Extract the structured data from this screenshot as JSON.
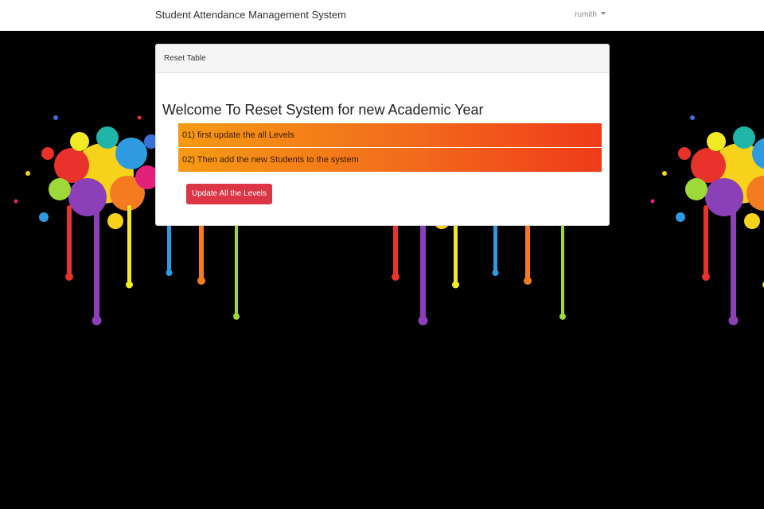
{
  "navbar": {
    "brand": "Student Attendance Management System",
    "user": "rumith"
  },
  "card": {
    "header": "Reset Table",
    "title": "Welcome To Reset System for new Academic Year",
    "steps": [
      "01) first update the all Levels",
      "02) Then add the new Students to the system"
    ],
    "button_label": "Update All the Levels"
  },
  "colors": {
    "button": "#dc3545",
    "step_gradient_start": "#f59a14",
    "step_gradient_end": "#ef3a19",
    "background": "#000000"
  }
}
